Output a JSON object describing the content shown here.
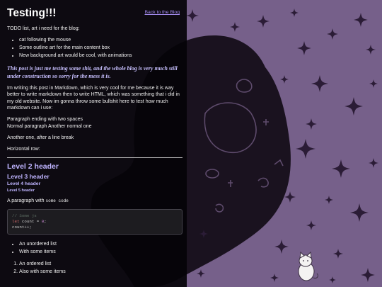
{
  "page": {
    "title": "Testing!!!",
    "back_link": "Back to the Blog"
  },
  "content": {
    "intro": "TODO list, art i need for the blog:",
    "todo": [
      "cat following the mouse",
      "Some outline art for the main content box",
      "New background art would be cool, with animations"
    ],
    "disclaimer": "This post is just me testing some shit, and the whole blog is very much still under construction so sorry for the mess it is.",
    "markdown_paragraph": "Im writing this post in Markdown, which is very cool for me because it is way better to write markdown then to write HTML, which was something that i did in my old website. Now im gonna throw some bullshit here to test how much markdown can i use:",
    "two_spaces_line1": "Paragraph ending with two spaces",
    "two_spaces_line2": "Normal paragraph Another normal one",
    "line_break": "Another one, after a line break",
    "horizontal": "Horizontal row:",
    "h2": "Level 2 header",
    "h3": "Level 3 header",
    "h4": "Level 4 header",
    "h5": "Level 5 header",
    "paragraph_with": "A paragraph with",
    "inline_code": "some code",
    "code": {
      "comment": "// Some js",
      "kw": "let",
      "decl": " count = ",
      "num": "0",
      "end": ";",
      "incr": "count++;"
    },
    "unordered": [
      "An unordered list",
      "With some items"
    ],
    "ordered": [
      "An ordered list",
      "Also with some items"
    ]
  },
  "colors": {
    "background": "#76608a",
    "blob": "#1a121f",
    "stars": "#2b1c36",
    "accent": "#bfb4ff"
  }
}
